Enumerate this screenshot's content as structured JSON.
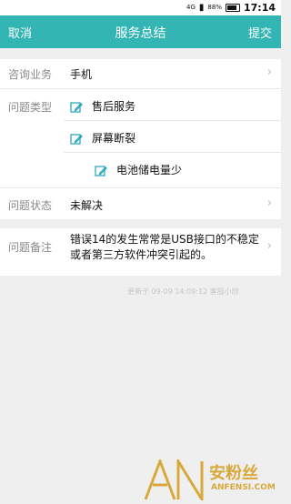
{
  "status": {
    "batteryPercent": "88%",
    "time": "17:14",
    "signal": "4G"
  },
  "appbar": {
    "left": "取消",
    "title": "服务总结",
    "right": "提交"
  },
  "form": {
    "consult": {
      "label": "咨询业务",
      "value": "手机"
    },
    "problemType": {
      "label": "问题类型",
      "items": [
        "售后服务",
        "屏幕断裂",
        "电池储电量少"
      ]
    },
    "problemStatus": {
      "label": "问题状态",
      "value": "未解决"
    },
    "problemNote": {
      "label": "问题备注",
      "text": "错误14的发生常常是USB接口的不稳定或者第三方软件冲突引起的。"
    },
    "meta": "更新于   09-09 14:09:12 客服小欣"
  },
  "watermark": {
    "cn": "安粉丝",
    "en": "ANFENSI.COM",
    "logo": "AN"
  },
  "colors": {
    "appbar": "#33b5b4",
    "accent": "#1aa3b8",
    "background": "#efefef",
    "watermark": "#d9a83c"
  }
}
